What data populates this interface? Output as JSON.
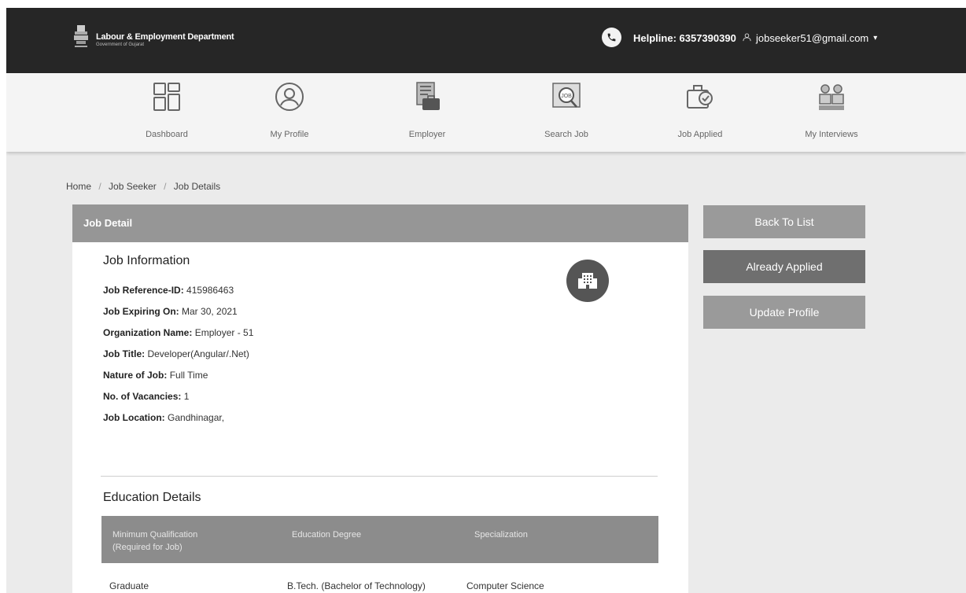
{
  "header": {
    "dept_name": "Labour & Employment Department",
    "dept_sub": "Government of Gujarat",
    "helpline": "Helpline: 6357390390",
    "user_email": "jobseeker51@gmail.com"
  },
  "nav": {
    "items": [
      {
        "label": "Dashboard",
        "icon": "dashboard-icon"
      },
      {
        "label": "My Profile",
        "icon": "profile-icon"
      },
      {
        "label": "Employer",
        "icon": "employer-icon"
      },
      {
        "label": "Search Job",
        "icon": "search-job-icon"
      },
      {
        "label": "Job Applied",
        "icon": "job-applied-icon"
      },
      {
        "label": "My Interviews",
        "icon": "interviews-icon"
      }
    ]
  },
  "breadcrumb": [
    "Home",
    "Job Seeker",
    "Job Details"
  ],
  "card": {
    "title": "Job Detail",
    "job_info_title": "Job Information",
    "fields": [
      {
        "label": "Job Reference-ID:",
        "value": "415986463"
      },
      {
        "label": "Job Expiring On:",
        "value": "Mar 30, 2021"
      },
      {
        "label": "Organization Name:",
        "value": "Employer - 51"
      },
      {
        "label": "Job Title:",
        "value": "Developer(Angular/.Net)"
      },
      {
        "label": "Nature of Job:",
        "value": "Full Time"
      },
      {
        "label": "No. of Vacancies:",
        "value": "1"
      },
      {
        "label": "Job Location:",
        "value": "Gandhinagar,"
      }
    ],
    "education_title": "Education Details",
    "education_headers": [
      "Minimum Qualification\n(Required for Job)",
      "Education Degree",
      "Specialization"
    ],
    "education_rows": [
      [
        "Graduate",
        "B.Tech. (Bachelor of Technology)",
        "Computer Science"
      ]
    ]
  },
  "actions": {
    "back": "Back To List",
    "applied": "Already Applied",
    "update": "Update Profile"
  }
}
